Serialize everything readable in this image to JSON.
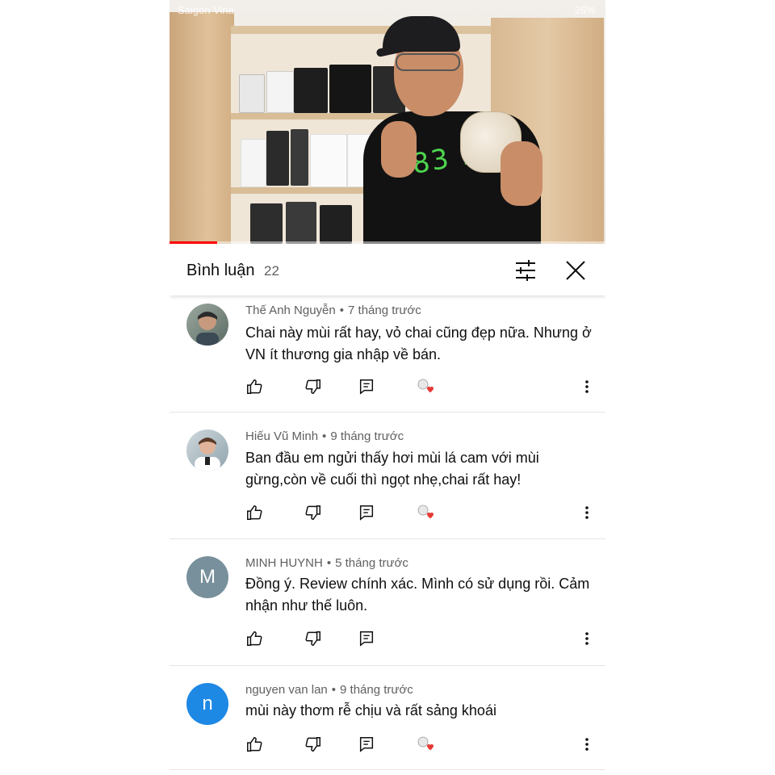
{
  "status_bar": {
    "carrier": "Saigon Vina",
    "battery": "26%"
  },
  "video": {
    "shirt_text": "83 19",
    "progress_fraction": 0.11
  },
  "header": {
    "title": "Bình luận",
    "count": "22",
    "filter_icon": "tune-icon",
    "close_icon": "close-icon"
  },
  "colors": {
    "accent_red": "#ff0000",
    "avatar_gray": "#78909c",
    "avatar_blue": "#1e88e5",
    "heart": "#e53935"
  },
  "comments": [
    {
      "author": "Thế Anh Nguyễn",
      "time": "7 tháng trước",
      "text": "Chai này mùi rất hay,  vỏ chai cũng đẹp nữa. Nhưng ở VN ít thương gia nhập về bán.",
      "avatar_letter": "",
      "hearted": true
    },
    {
      "author": "Hiếu Vũ Minh",
      "time": "9 tháng trước",
      "text": "Ban đầu em ngửi thấy hơi mùi lá cam với mùi gừng,còn về cuối thì ngọt nhẹ,chai rất hay!",
      "avatar_letter": "",
      "hearted": true
    },
    {
      "author": "MINH HUYNH",
      "time": "5 tháng trước",
      "text": "Đồng ý. Review chính xác. Mình có sử dụng rồi. Cảm nhận như thế luôn.",
      "avatar_letter": "M",
      "hearted": false
    },
    {
      "author": "nguyen van lan",
      "time": "9 tháng trước",
      "text": "mùi này thơm rễ chịu và rất sảng khoái",
      "avatar_letter": "n",
      "hearted": true
    }
  ]
}
